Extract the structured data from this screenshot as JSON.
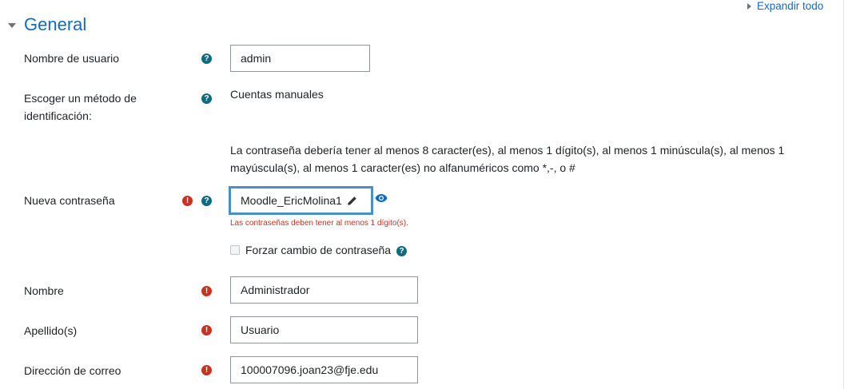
{
  "expand_all": "Expandir todo",
  "section": {
    "title": "General"
  },
  "fields": {
    "username": {
      "label": "Nombre de usuario",
      "value": "admin"
    },
    "auth": {
      "label_line1": "Escoger un método de",
      "label_line2": "identificación:",
      "value": "Cuentas manuales"
    },
    "password_policy": {
      "line1": "La contraseña debería tener al menos 8 caracter(es), al menos 1 dígito(s), al menos 1 minúscula(s), al menos 1",
      "line2": "mayúscula(s), al menos 1 caracter(es) no alfanuméricos como *,-, o #"
    },
    "new_password": {
      "label": "Nueva contraseña",
      "value": "Moodle_EricMolina1",
      "error": "Las contraseñas deben tener al menos 1 dígito(s)."
    },
    "force_change": {
      "label": "Forzar cambio de contraseña"
    },
    "firstname": {
      "label": "Nombre",
      "value": "Administrador"
    },
    "lastname": {
      "label": "Apellido(s)",
      "value": "Usuario"
    },
    "email": {
      "label": "Dirección de correo",
      "value": "100007096.joan23@fje.edu"
    }
  },
  "icons": {
    "help": "question-circle-icon",
    "required": "exclamation-circle-icon",
    "edit": "pencil-icon",
    "reveal": "eye-icon"
  },
  "colors": {
    "link": "#0f6cbf",
    "help": "#0f6c7f",
    "required": "#ca3120",
    "focus_border": "#4a90c8"
  }
}
